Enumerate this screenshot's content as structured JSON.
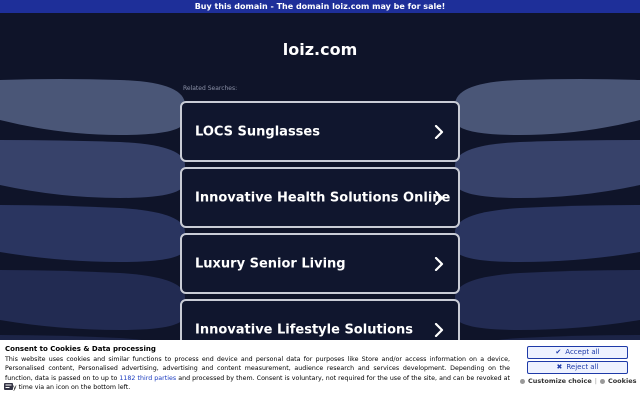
{
  "banner": {
    "text": "Buy this domain - The domain loiz.com may be for sale!"
  },
  "domain": "loiz.com",
  "related_label": "Related Searches:",
  "searches": [
    {
      "label": "LOCS Sunglasses"
    },
    {
      "label": "Innovative Health Solutions Online"
    },
    {
      "label": "Luxury Senior Living"
    },
    {
      "label": "Innovative Lifestyle Solutions"
    }
  ],
  "consent": {
    "title": "Consent to Cookies & Data processing",
    "text_before": "This website uses cookies and similar functions to process end device and personal data for purposes like Store and/or access information on a device, Personalised content, Personalised advertising, advertising and content measurement, audience research and services development. Depending on the function, data is passed on to up to ",
    "link_text": "1182 third parties",
    "text_after": " and processed by them. Consent is voluntary, not required for the use of the site, and can be revoked at any time via an icon on the bottom left.",
    "accept_label": "Accept all",
    "reject_label": "Reject all",
    "customize_label": "Customize choice",
    "cookies_label": "Cookies"
  },
  "colors": {
    "background": "#0f1429",
    "banner": "#1e2f99",
    "button_border": "#c9ccd6",
    "accent": "#1e3aa8"
  }
}
